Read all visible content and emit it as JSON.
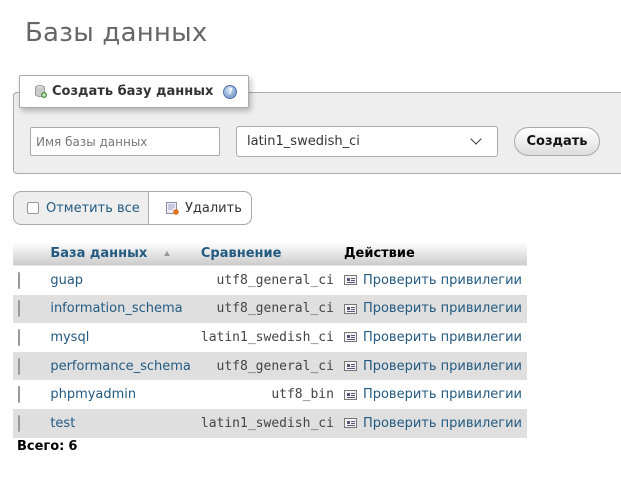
{
  "page": {
    "title": "Базы данных"
  },
  "create_db": {
    "legend": "Создать базу данных",
    "name_placeholder": "Имя базы данных",
    "collation_selected": "latin1_swedish_ci",
    "create_label": "Создать"
  },
  "actions": {
    "check_all_label": "Отметить все",
    "delete_label": "Удалить"
  },
  "table": {
    "headers": {
      "database": "База данных",
      "collation": "Сравнение",
      "action": "Действие"
    },
    "rows": [
      {
        "name": "guap",
        "collation": "utf8_general_ci",
        "action": "Проверить привилегии"
      },
      {
        "name": "information_schema",
        "collation": "utf8_general_ci",
        "action": "Проверить привилегии"
      },
      {
        "name": "mysql",
        "collation": "latin1_swedish_ci",
        "action": "Проверить привилегии"
      },
      {
        "name": "performance_schema",
        "collation": "utf8_general_ci",
        "action": "Проверить привилегии"
      },
      {
        "name": "phpmyadmin",
        "collation": "utf8_bin",
        "action": "Проверить привилегии"
      },
      {
        "name": "test",
        "collation": "latin1_swedish_ci",
        "action": "Проверить привилегии"
      }
    ]
  },
  "footer": {
    "total_label": "Всего:",
    "total_count": "6"
  },
  "colors": {
    "link": "#235a81",
    "row_alt": "#dfdfdf",
    "panel": "#eeeeee"
  }
}
